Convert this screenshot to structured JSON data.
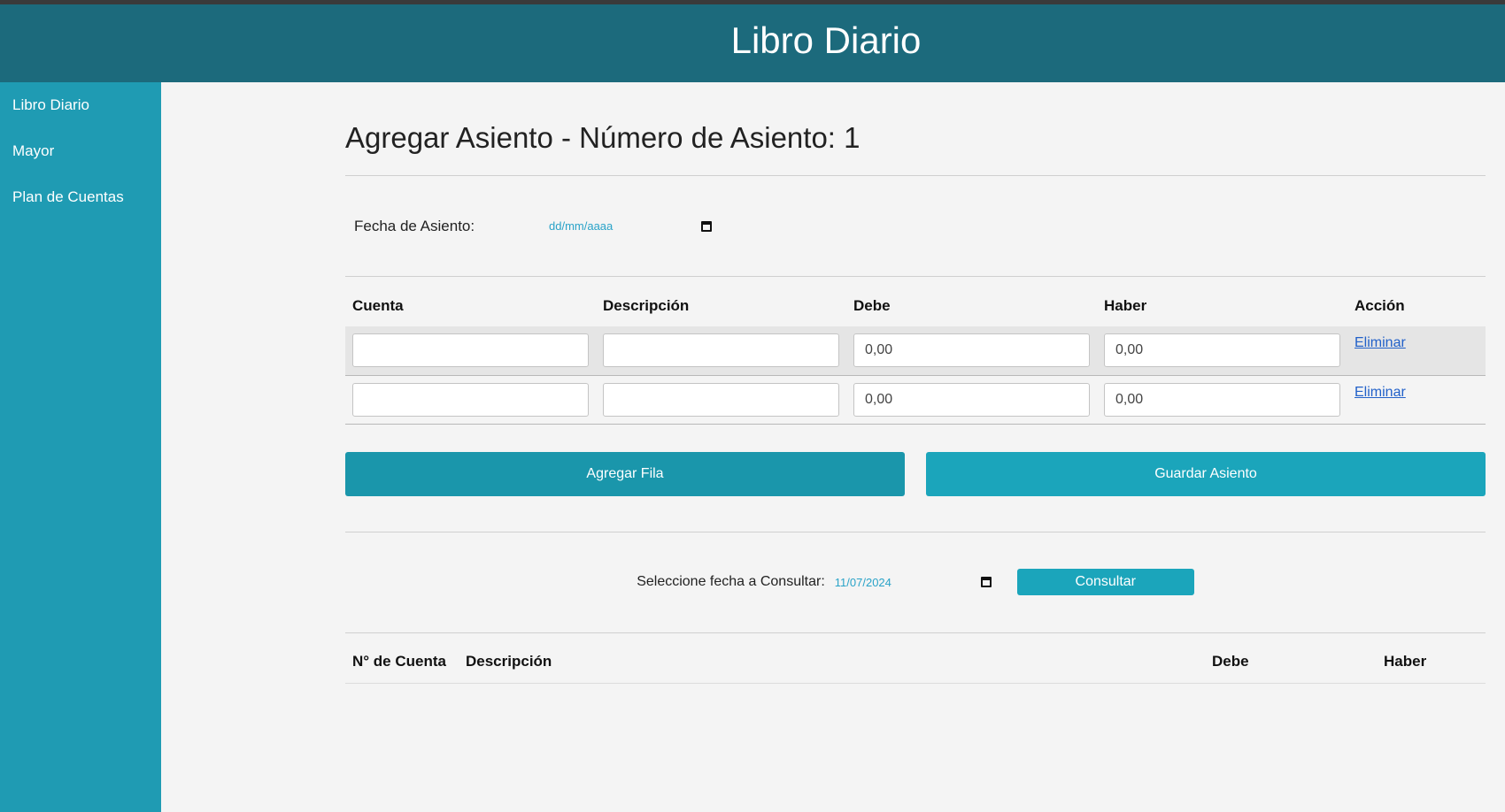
{
  "header": {
    "title": "Libro Diario"
  },
  "sidebar": {
    "items": [
      {
        "label": "Libro Diario"
      },
      {
        "label": "Mayor"
      },
      {
        "label": "Plan de Cuentas"
      }
    ]
  },
  "main": {
    "title": "Agregar Asiento - Número de Asiento: 1",
    "fecha_label": "Fecha de Asiento:",
    "fecha_placeholder": "dd/mm/aaaa",
    "table": {
      "headers": [
        "Cuenta",
        "Descripción",
        "Debe",
        "Haber",
        "Acción"
      ],
      "rows": [
        {
          "cuenta": "",
          "descripcion": "",
          "debe": "0,00",
          "haber": "0,00",
          "accion": "Eliminar"
        },
        {
          "cuenta": "",
          "descripcion": "",
          "debe": "0,00",
          "haber": "0,00",
          "accion": "Eliminar"
        }
      ]
    },
    "add_row_label": "Agregar Fila",
    "save_label": "Guardar Asiento",
    "consult": {
      "label": "Seleccione fecha a Consultar:",
      "date_value": "11/07/2024",
      "button_label": "Consultar"
    },
    "results": {
      "headers": [
        "N° de Cuenta",
        "Descripción",
        "Debe",
        "Haber"
      ]
    }
  },
  "colors": {
    "header_bg": "#1c6a7c",
    "sidebar_bg": "#1f9bb3",
    "button_accent": "#1ba5bb",
    "link": "#2261c9"
  }
}
